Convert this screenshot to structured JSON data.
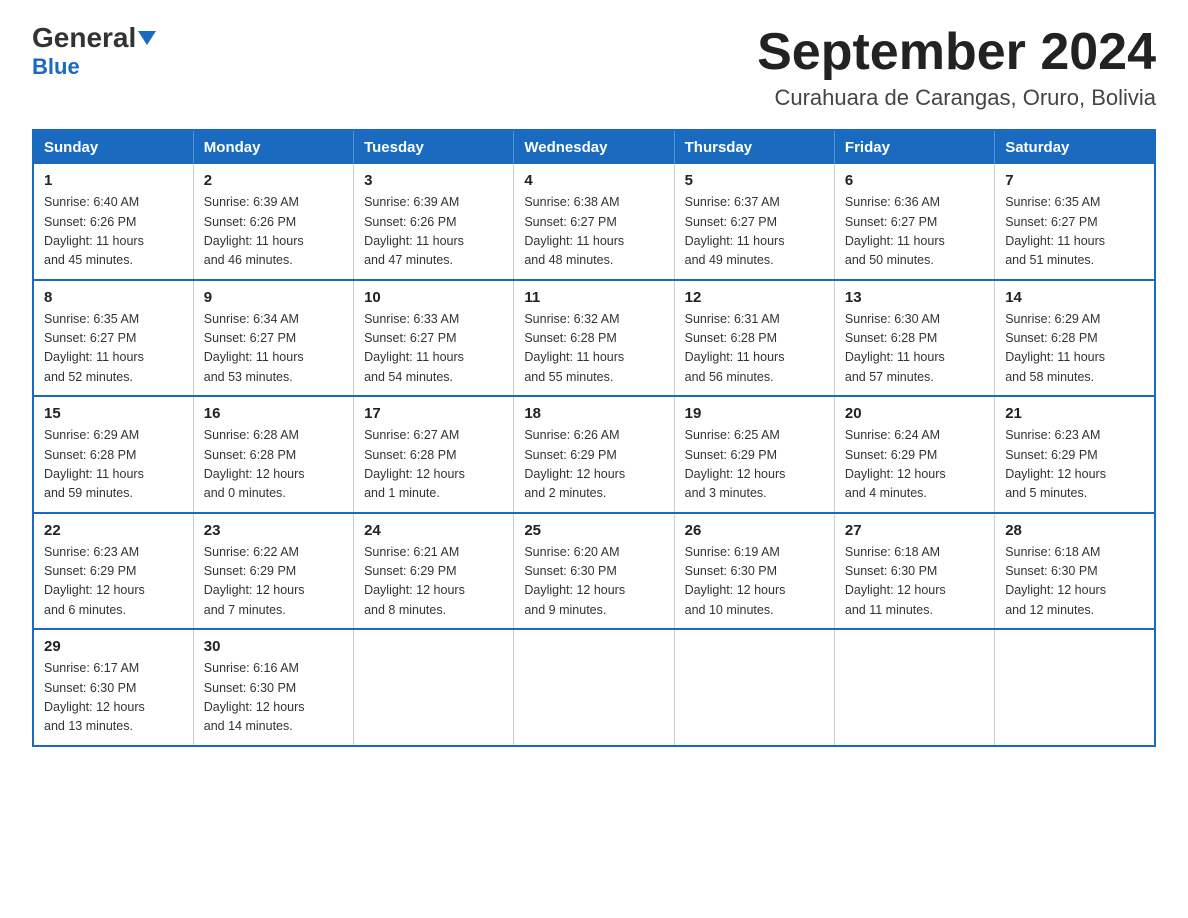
{
  "logo": {
    "general": "General",
    "blue": "Blue"
  },
  "header": {
    "month": "September 2024",
    "location": "Curahuara de Carangas, Oruro, Bolivia"
  },
  "days_of_week": [
    "Sunday",
    "Monday",
    "Tuesday",
    "Wednesday",
    "Thursday",
    "Friday",
    "Saturday"
  ],
  "weeks": [
    [
      {
        "num": "1",
        "sunrise": "6:40 AM",
        "sunset": "6:26 PM",
        "daylight": "11 hours and 45 minutes."
      },
      {
        "num": "2",
        "sunrise": "6:39 AM",
        "sunset": "6:26 PM",
        "daylight": "11 hours and 46 minutes."
      },
      {
        "num": "3",
        "sunrise": "6:39 AM",
        "sunset": "6:26 PM",
        "daylight": "11 hours and 47 minutes."
      },
      {
        "num": "4",
        "sunrise": "6:38 AM",
        "sunset": "6:27 PM",
        "daylight": "11 hours and 48 minutes."
      },
      {
        "num": "5",
        "sunrise": "6:37 AM",
        "sunset": "6:27 PM",
        "daylight": "11 hours and 49 minutes."
      },
      {
        "num": "6",
        "sunrise": "6:36 AM",
        "sunset": "6:27 PM",
        "daylight": "11 hours and 50 minutes."
      },
      {
        "num": "7",
        "sunrise": "6:35 AM",
        "sunset": "6:27 PM",
        "daylight": "11 hours and 51 minutes."
      }
    ],
    [
      {
        "num": "8",
        "sunrise": "6:35 AM",
        "sunset": "6:27 PM",
        "daylight": "11 hours and 52 minutes."
      },
      {
        "num": "9",
        "sunrise": "6:34 AM",
        "sunset": "6:27 PM",
        "daylight": "11 hours and 53 minutes."
      },
      {
        "num": "10",
        "sunrise": "6:33 AM",
        "sunset": "6:27 PM",
        "daylight": "11 hours and 54 minutes."
      },
      {
        "num": "11",
        "sunrise": "6:32 AM",
        "sunset": "6:28 PM",
        "daylight": "11 hours and 55 minutes."
      },
      {
        "num": "12",
        "sunrise": "6:31 AM",
        "sunset": "6:28 PM",
        "daylight": "11 hours and 56 minutes."
      },
      {
        "num": "13",
        "sunrise": "6:30 AM",
        "sunset": "6:28 PM",
        "daylight": "11 hours and 57 minutes."
      },
      {
        "num": "14",
        "sunrise": "6:29 AM",
        "sunset": "6:28 PM",
        "daylight": "11 hours and 58 minutes."
      }
    ],
    [
      {
        "num": "15",
        "sunrise": "6:29 AM",
        "sunset": "6:28 PM",
        "daylight": "11 hours and 59 minutes."
      },
      {
        "num": "16",
        "sunrise": "6:28 AM",
        "sunset": "6:28 PM",
        "daylight": "12 hours and 0 minutes."
      },
      {
        "num": "17",
        "sunrise": "6:27 AM",
        "sunset": "6:28 PM",
        "daylight": "12 hours and 1 minute."
      },
      {
        "num": "18",
        "sunrise": "6:26 AM",
        "sunset": "6:29 PM",
        "daylight": "12 hours and 2 minutes."
      },
      {
        "num": "19",
        "sunrise": "6:25 AM",
        "sunset": "6:29 PM",
        "daylight": "12 hours and 3 minutes."
      },
      {
        "num": "20",
        "sunrise": "6:24 AM",
        "sunset": "6:29 PM",
        "daylight": "12 hours and 4 minutes."
      },
      {
        "num": "21",
        "sunrise": "6:23 AM",
        "sunset": "6:29 PM",
        "daylight": "12 hours and 5 minutes."
      }
    ],
    [
      {
        "num": "22",
        "sunrise": "6:23 AM",
        "sunset": "6:29 PM",
        "daylight": "12 hours and 6 minutes."
      },
      {
        "num": "23",
        "sunrise": "6:22 AM",
        "sunset": "6:29 PM",
        "daylight": "12 hours and 7 minutes."
      },
      {
        "num": "24",
        "sunrise": "6:21 AM",
        "sunset": "6:29 PM",
        "daylight": "12 hours and 8 minutes."
      },
      {
        "num": "25",
        "sunrise": "6:20 AM",
        "sunset": "6:30 PM",
        "daylight": "12 hours and 9 minutes."
      },
      {
        "num": "26",
        "sunrise": "6:19 AM",
        "sunset": "6:30 PM",
        "daylight": "12 hours and 10 minutes."
      },
      {
        "num": "27",
        "sunrise": "6:18 AM",
        "sunset": "6:30 PM",
        "daylight": "12 hours and 11 minutes."
      },
      {
        "num": "28",
        "sunrise": "6:18 AM",
        "sunset": "6:30 PM",
        "daylight": "12 hours and 12 minutes."
      }
    ],
    [
      {
        "num": "29",
        "sunrise": "6:17 AM",
        "sunset": "6:30 PM",
        "daylight": "12 hours and 13 minutes."
      },
      {
        "num": "30",
        "sunrise": "6:16 AM",
        "sunset": "6:30 PM",
        "daylight": "12 hours and 14 minutes."
      },
      null,
      null,
      null,
      null,
      null
    ]
  ],
  "labels": {
    "sunrise": "Sunrise:",
    "sunset": "Sunset:",
    "daylight": "Daylight:"
  }
}
